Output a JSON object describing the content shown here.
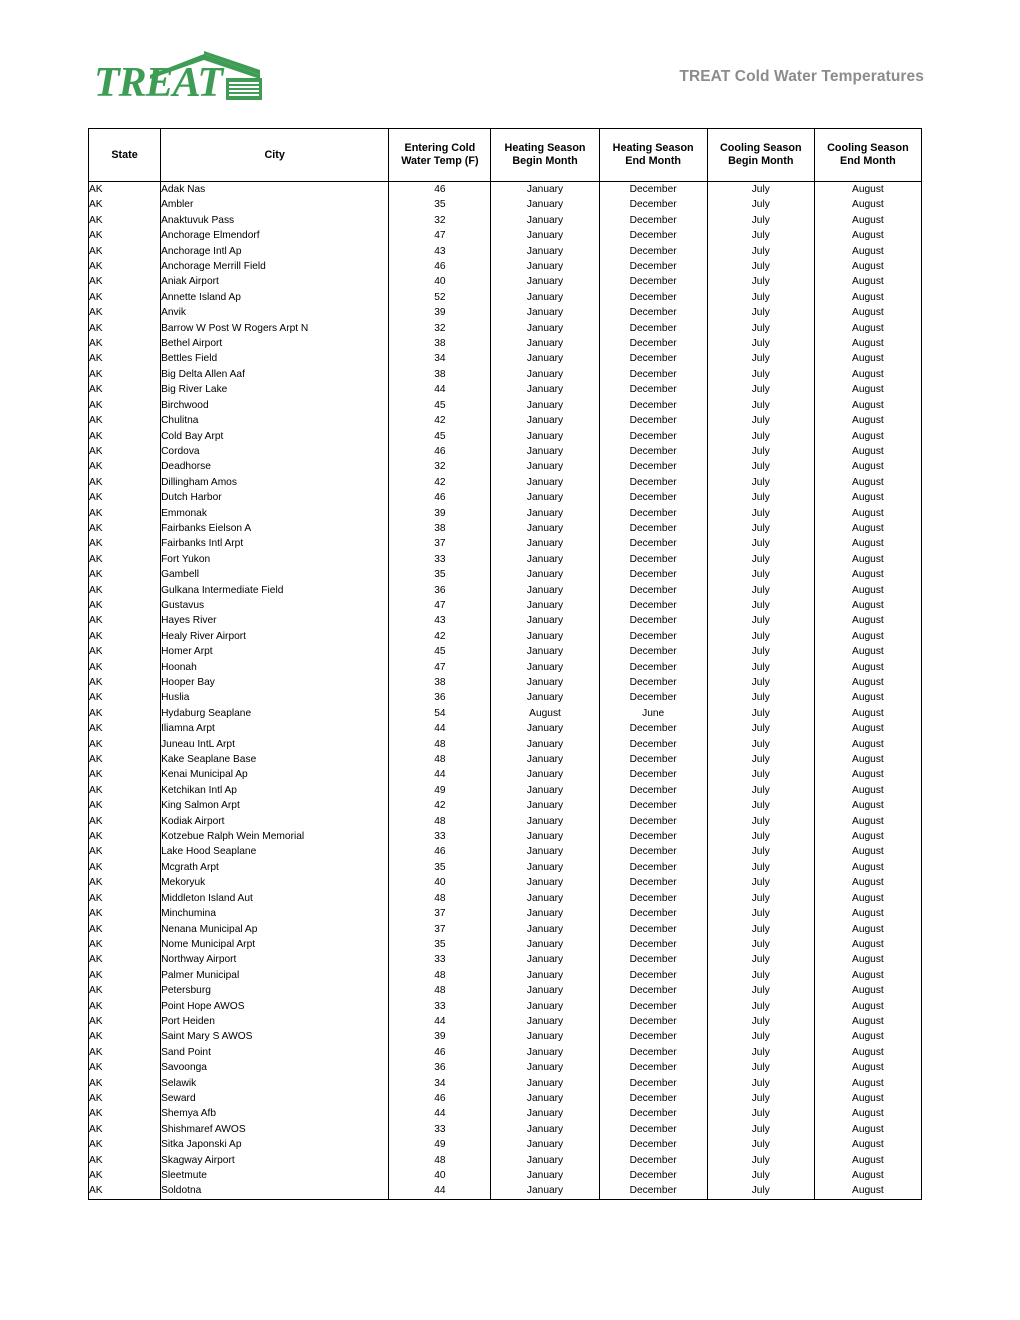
{
  "header": {
    "logo_text": "TREAT",
    "logo_color": "#3f9c54",
    "title": "TREAT Cold Water Temperatures",
    "title_color": "#8c8c8c"
  },
  "table": {
    "columns": [
      "State",
      "City",
      "Entering Cold Water Temp (F)",
      "Heating Season Begin Month",
      "Heating Season End Month",
      "Cooling Season Begin Month",
      "Cooling Season End Month"
    ],
    "columns_lines": [
      [
        "State",
        ""
      ],
      [
        "City",
        ""
      ],
      [
        "Entering Cold",
        "Water Temp (F)"
      ],
      [
        "Heating Season",
        "Begin Month"
      ],
      [
        "Heating Season",
        "End Month"
      ],
      [
        "Cooling Season",
        "Begin Month"
      ],
      [
        "Cooling Season",
        "End Month"
      ]
    ],
    "rows": [
      [
        "AK",
        "Adak Nas",
        "46",
        "January",
        "December",
        "July",
        "August"
      ],
      [
        "AK",
        "Ambler",
        "35",
        "January",
        "December",
        "July",
        "August"
      ],
      [
        "AK",
        "Anaktuvuk Pass",
        "32",
        "January",
        "December",
        "July",
        "August"
      ],
      [
        "AK",
        "Anchorage Elmendorf",
        "47",
        "January",
        "December",
        "July",
        "August"
      ],
      [
        "AK",
        "Anchorage Intl Ap",
        "43",
        "January",
        "December",
        "July",
        "August"
      ],
      [
        "AK",
        "Anchorage Merrill Field",
        "46",
        "January",
        "December",
        "July",
        "August"
      ],
      [
        "AK",
        "Aniak Airport",
        "40",
        "January",
        "December",
        "July",
        "August"
      ],
      [
        "AK",
        "Annette Island Ap",
        "52",
        "January",
        "December",
        "July",
        "August"
      ],
      [
        "AK",
        "Anvik",
        "39",
        "January",
        "December",
        "July",
        "August"
      ],
      [
        "AK",
        "Barrow W Post W Rogers Arpt  N",
        "32",
        "January",
        "December",
        "July",
        "August"
      ],
      [
        "AK",
        "Bethel Airport",
        "38",
        "January",
        "December",
        "July",
        "August"
      ],
      [
        "AK",
        "Bettles Field",
        "34",
        "January",
        "December",
        "July",
        "August"
      ],
      [
        "AK",
        "Big Delta Allen Aaf",
        "38",
        "January",
        "December",
        "July",
        "August"
      ],
      [
        "AK",
        "Big River Lake",
        "44",
        "January",
        "December",
        "July",
        "August"
      ],
      [
        "AK",
        "Birchwood",
        "45",
        "January",
        "December",
        "July",
        "August"
      ],
      [
        "AK",
        "Chulitna",
        "42",
        "January",
        "December",
        "July",
        "August"
      ],
      [
        "AK",
        "Cold Bay Arpt",
        "45",
        "January",
        "December",
        "July",
        "August"
      ],
      [
        "AK",
        "Cordova",
        "46",
        "January",
        "December",
        "July",
        "August"
      ],
      [
        "AK",
        "Deadhorse",
        "32",
        "January",
        "December",
        "July",
        "August"
      ],
      [
        "AK",
        "Dillingham  Amos",
        "42",
        "January",
        "December",
        "July",
        "August"
      ],
      [
        "AK",
        "Dutch Harbor",
        "46",
        "January",
        "December",
        "July",
        "August"
      ],
      [
        "AK",
        "Emmonak",
        "39",
        "January",
        "December",
        "July",
        "August"
      ],
      [
        "AK",
        "Fairbanks Eielson A",
        "38",
        "January",
        "December",
        "July",
        "August"
      ],
      [
        "AK",
        "Fairbanks Intl Arpt",
        "37",
        "January",
        "December",
        "July",
        "August"
      ],
      [
        "AK",
        "Fort Yukon",
        "33",
        "January",
        "December",
        "July",
        "August"
      ],
      [
        "AK",
        "Gambell",
        "35",
        "January",
        "December",
        "July",
        "August"
      ],
      [
        "AK",
        "Gulkana Intermediate Field",
        "36",
        "January",
        "December",
        "July",
        "August"
      ],
      [
        "AK",
        "Gustavus",
        "47",
        "January",
        "December",
        "July",
        "August"
      ],
      [
        "AK",
        "Hayes River",
        "43",
        "January",
        "December",
        "July",
        "August"
      ],
      [
        "AK",
        "Healy River Airport",
        "42",
        "January",
        "December",
        "July",
        "August"
      ],
      [
        "AK",
        "Homer Arpt",
        "45",
        "January",
        "December",
        "July",
        "August"
      ],
      [
        "AK",
        "Hoonah",
        "47",
        "January",
        "December",
        "July",
        "August"
      ],
      [
        "AK",
        "Hooper Bay",
        "38",
        "January",
        "December",
        "July",
        "August"
      ],
      [
        "AK",
        "Huslia",
        "36",
        "January",
        "December",
        "July",
        "August"
      ],
      [
        "AK",
        "Hydaburg Seaplane",
        "54",
        "August",
        "June",
        "July",
        "August"
      ],
      [
        "AK",
        "Iliamna Arpt",
        "44",
        "January",
        "December",
        "July",
        "August"
      ],
      [
        "AK",
        "Juneau IntL Arpt",
        "48",
        "January",
        "December",
        "July",
        "August"
      ],
      [
        "AK",
        "Kake Seaplane Base",
        "48",
        "January",
        "December",
        "July",
        "August"
      ],
      [
        "AK",
        "Kenai Municipal Ap",
        "44",
        "January",
        "December",
        "July",
        "August"
      ],
      [
        "AK",
        "Ketchikan Intl Ap",
        "49",
        "January",
        "December",
        "July",
        "August"
      ],
      [
        "AK",
        "King Salmon Arpt",
        "42",
        "January",
        "December",
        "July",
        "August"
      ],
      [
        "AK",
        "Kodiak Airport",
        "48",
        "January",
        "December",
        "July",
        "August"
      ],
      [
        "AK",
        "Kotzebue Ralph Wein Memorial",
        "33",
        "January",
        "December",
        "July",
        "August"
      ],
      [
        "AK",
        "Lake Hood Seaplane",
        "46",
        "January",
        "December",
        "July",
        "August"
      ],
      [
        "AK",
        "Mcgrath Arpt",
        "35",
        "January",
        "December",
        "July",
        "August"
      ],
      [
        "AK",
        "Mekoryuk",
        "40",
        "January",
        "December",
        "July",
        "August"
      ],
      [
        "AK",
        "Middleton Island Aut",
        "48",
        "January",
        "December",
        "July",
        "August"
      ],
      [
        "AK",
        "Minchumina",
        "37",
        "January",
        "December",
        "July",
        "August"
      ],
      [
        "AK",
        "Nenana Municipal Ap",
        "37",
        "January",
        "December",
        "July",
        "August"
      ],
      [
        "AK",
        "Nome Municipal Arpt",
        "35",
        "January",
        "December",
        "July",
        "August"
      ],
      [
        "AK",
        "Northway Airport",
        "33",
        "January",
        "December",
        "July",
        "August"
      ],
      [
        "AK",
        "Palmer Municipal",
        "48",
        "January",
        "December",
        "July",
        "August"
      ],
      [
        "AK",
        "Petersburg",
        "48",
        "January",
        "December",
        "July",
        "August"
      ],
      [
        "AK",
        "Point Hope AWOS",
        "33",
        "January",
        "December",
        "July",
        "August"
      ],
      [
        "AK",
        "Port Heiden",
        "44",
        "January",
        "December",
        "July",
        "August"
      ],
      [
        "AK",
        "Saint Mary S AWOS",
        "39",
        "January",
        "December",
        "July",
        "August"
      ],
      [
        "AK",
        "Sand Point",
        "46",
        "January",
        "December",
        "July",
        "August"
      ],
      [
        "AK",
        "Savoonga",
        "36",
        "January",
        "December",
        "July",
        "August"
      ],
      [
        "AK",
        "Selawik",
        "34",
        "January",
        "December",
        "July",
        "August"
      ],
      [
        "AK",
        "Seward",
        "46",
        "January",
        "December",
        "July",
        "August"
      ],
      [
        "AK",
        "Shemya Afb",
        "44",
        "January",
        "December",
        "July",
        "August"
      ],
      [
        "AK",
        "Shishmaref AWOS",
        "33",
        "January",
        "December",
        "July",
        "August"
      ],
      [
        "AK",
        "Sitka Japonski Ap",
        "49",
        "January",
        "December",
        "July",
        "August"
      ],
      [
        "AK",
        "Skagway Airport",
        "48",
        "January",
        "December",
        "July",
        "August"
      ],
      [
        "AK",
        "Sleetmute",
        "40",
        "January",
        "December",
        "July",
        "August"
      ],
      [
        "AK",
        "Soldotna",
        "44",
        "January",
        "December",
        "July",
        "August"
      ]
    ]
  }
}
